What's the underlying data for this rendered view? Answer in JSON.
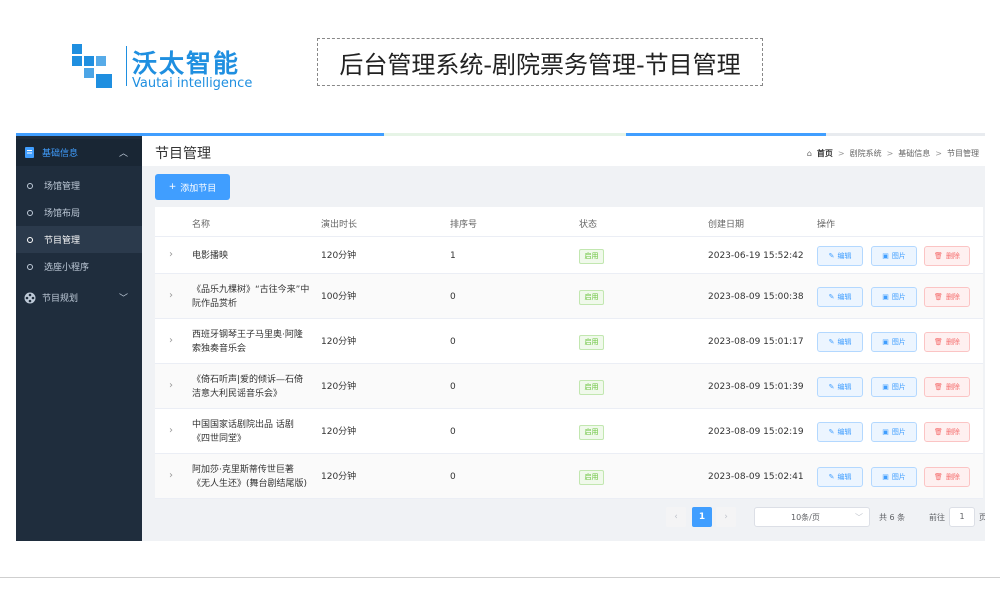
{
  "header": {
    "logo_cn": "沃太智能",
    "logo_en": "Vautai intelligence",
    "page_heading": "后台管理系统-剧院票务管理-节目管理"
  },
  "sidebar": {
    "groups": [
      {
        "label": "基础信息",
        "icon": "document-icon",
        "expanded": true,
        "items": [
          {
            "label": "场馆管理",
            "active": false
          },
          {
            "label": "场馆布局",
            "active": false
          },
          {
            "label": "节目管理",
            "active": true
          },
          {
            "label": "选座小程序",
            "active": false
          }
        ]
      },
      {
        "label": "节目规划",
        "icon": "film-reel-icon",
        "expanded": false,
        "items": []
      }
    ]
  },
  "main": {
    "title": "节目管理",
    "breadcrumb": [
      "首页",
      "剧院系统",
      "基础信息",
      "节目管理"
    ],
    "add_button": "添加节目",
    "columns": [
      "名称",
      "演出时长",
      "排序号",
      "状态",
      "创建日期",
      "操作"
    ],
    "rows": [
      {
        "name": "电影播映",
        "duration": "120分钟",
        "order": "1",
        "status": "启用",
        "created": "2023-06-19 15:52:42"
      },
      {
        "name": "《品乐九棵树》“古往今来”中阮作品赏析",
        "duration": "100分钟",
        "order": "0",
        "status": "启用",
        "created": "2023-08-09 15:00:38"
      },
      {
        "name": "西班牙钢琴王子马里奥·阿隆索独奏音乐会",
        "duration": "120分钟",
        "order": "0",
        "status": "启用",
        "created": "2023-08-09 15:01:17"
      },
      {
        "name": "《倚石听声|爱的倾诉—石倚洁意大利民谣音乐会》",
        "duration": "120分钟",
        "order": "0",
        "status": "启用",
        "created": "2023-08-09 15:01:39"
      },
      {
        "name": "中国国家话剧院出品 话剧《四世同堂》",
        "duration": "120分钟",
        "order": "0",
        "status": "启用",
        "created": "2023-08-09 15:02:19"
      },
      {
        "name": "阿加莎·克里斯蒂传世巨著《无人生还》(舞台剧结尾版)",
        "duration": "120分钟",
        "order": "0",
        "status": "启用",
        "created": "2023-08-09 15:02:41"
      }
    ],
    "actions": {
      "edit": "编辑",
      "picture": "图片",
      "delete": "删除"
    },
    "pagination": {
      "current_page": "1",
      "page_size": "10条/页",
      "total": "共 6 条",
      "goto_label": "前往",
      "goto_value": "1",
      "page_unit": "页"
    }
  },
  "colors": {
    "primary": "#409eff",
    "sidebar_bg": "#1f2d3d",
    "success": "#67c23a",
    "danger": "#f56c6c",
    "brand": "#1f8fe0"
  }
}
